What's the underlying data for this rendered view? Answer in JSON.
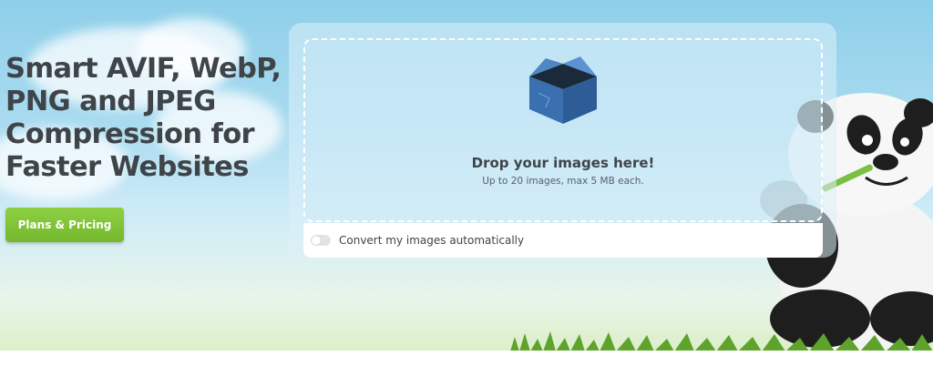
{
  "hero": {
    "headline_lines": [
      "Smart AVIF, WebP,",
      "PNG and JPEG",
      "Compression for",
      "Faster Websites"
    ],
    "cta_label": "Plans & Pricing"
  },
  "uploader": {
    "icon": "box-icon",
    "title": "Drop your images here!",
    "subtitle": "Up to 20 images, max 5 MB each.",
    "convert_label": "Convert my images automatically",
    "convert_enabled": false
  },
  "colors": {
    "cta": "#7ec13a",
    "text": "#3f4448",
    "sky": "#8ecfe9",
    "box": "#3a6fb0"
  },
  "illustration": "panda-mascot"
}
